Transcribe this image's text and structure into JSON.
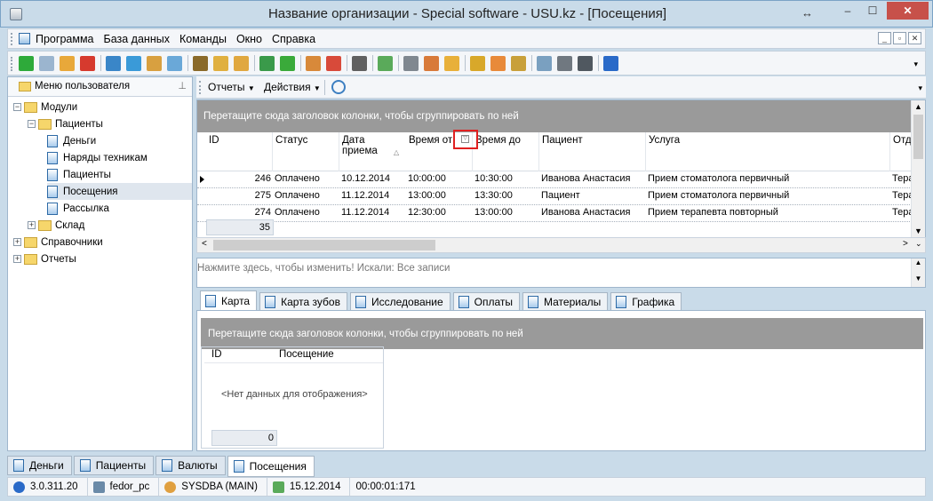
{
  "window": {
    "title": "Название организации - Special software - USU.kz - [Посещения]",
    "minimize": "–",
    "maximize": "☐",
    "close": "✕",
    "resize_glyph": "↔"
  },
  "menu": {
    "items": [
      "Программа",
      "База данных",
      "Команды",
      "Окно",
      "Справка"
    ],
    "mdi": [
      "_",
      "▫",
      "✕"
    ]
  },
  "toolbar": {
    "icons": [
      {
        "name": "add-icon",
        "color": "#2eaa3a"
      },
      {
        "name": "copy-icon",
        "color": "#9bb5cf"
      },
      {
        "name": "edit-icon",
        "color": "#e8a83a"
      },
      {
        "name": "delete-icon",
        "color": "#d63a2e"
      },
      {
        "sep": true
      },
      {
        "name": "search-icon",
        "color": "#3a86c8"
      },
      {
        "name": "refresh-icon",
        "color": "#3a9ad8"
      },
      {
        "name": "tree-icon",
        "color": "#d8a040"
      },
      {
        "name": "comment-icon",
        "color": "#6aa8d8"
      },
      {
        "sep": true
      },
      {
        "name": "binoculars-icon",
        "color": "#8a6a2a"
      },
      {
        "name": "filter-icon",
        "color": "#e0b040"
      },
      {
        "name": "group-icon",
        "color": "#e0a840"
      },
      {
        "sep": true
      },
      {
        "name": "export-icon",
        "color": "#3a9a4a"
      },
      {
        "name": "import-icon",
        "color": "#3aaa3a"
      },
      {
        "sep": true
      },
      {
        "name": "new-window-icon",
        "color": "#d8893a"
      },
      {
        "name": "close-window-icon",
        "color": "#d84a3a"
      },
      {
        "sep": true
      },
      {
        "name": "print-preview-icon",
        "color": "#606060"
      },
      {
        "sep": true
      },
      {
        "name": "calendar-icon",
        "color": "#5aaa5a"
      },
      {
        "sep": true
      },
      {
        "name": "tools-icon",
        "color": "#808890"
      },
      {
        "name": "palette-icon",
        "color": "#d87a3a"
      },
      {
        "name": "form-icon",
        "color": "#e8b03a"
      },
      {
        "sep": true
      },
      {
        "name": "lock-icon",
        "color": "#d8a82a"
      },
      {
        "name": "users-icon",
        "color": "#e88a3a"
      },
      {
        "name": "key-icon",
        "color": "#c8a03a"
      },
      {
        "sep": true
      },
      {
        "name": "table-icon",
        "color": "#7aa0c0"
      },
      {
        "name": "printer-icon",
        "color": "#707880"
      },
      {
        "name": "play-icon",
        "color": "#505860"
      },
      {
        "sep": true
      },
      {
        "name": "info-icon",
        "color": "#2a6ac8"
      }
    ],
    "more": "▾"
  },
  "left_panel": {
    "title": "Меню пользователя",
    "pin": "⊥",
    "tree": [
      {
        "label": "Модули",
        "type": "folder",
        "exp": "−"
      },
      {
        "label": "Пациенты",
        "type": "folder",
        "exp": "−"
      },
      {
        "label": "Деньги",
        "type": "leaf"
      },
      {
        "label": "Наряды техникам",
        "type": "leaf"
      },
      {
        "label": "Пациенты",
        "type": "leaf"
      },
      {
        "label": "Посещения",
        "type": "leaf",
        "selected": true
      },
      {
        "label": "Рассылка",
        "type": "leaf"
      },
      {
        "label": "Склад",
        "type": "folder",
        "exp": "+"
      },
      {
        "label": "Справочники",
        "type": "folder",
        "exp": "+"
      },
      {
        "label": "Отчеты",
        "type": "folder",
        "exp": "+"
      }
    ]
  },
  "right_toolbar": {
    "reports": "Отчеты",
    "actions": "Действия",
    "more": "▾"
  },
  "grid": {
    "group_hint": "Перетащите сюда заголовок колонки, чтобы сгруппировать по ней",
    "columns": [
      "ID",
      "Статус",
      "Дата приема",
      "Время от",
      "Время до",
      "Пациент",
      "Услуга",
      "Отд"
    ],
    "rows": [
      [
        "246",
        "Оплачено",
        "10.12.2014",
        "10:00:00",
        "10:30:00",
        "Иванова Анастасия",
        "Прием стоматолога первичный",
        "Тера"
      ],
      [
        "275",
        "Оплачено",
        "11.12.2014",
        "13:00:00",
        "13:30:00",
        "Пациент",
        "Прием стоматолога первичный",
        "Тера"
      ],
      [
        "274",
        "Оплачено",
        "11.12.2014",
        "12:30:00",
        "13:00:00",
        "Иванова Анастасия",
        "Прием терапевта повторный",
        "Тера"
      ]
    ],
    "count": "35",
    "filter_glyph": "▽"
  },
  "search": {
    "text": "Нажмите здесь, чтобы изменить! Искали: Все записи"
  },
  "detail_tabs": [
    "Карта",
    "Карта зубов",
    "Исследование",
    "Оплаты",
    "Материалы",
    "Графика"
  ],
  "detail": {
    "group_hint": "Перетащите сюда заголовок колонки, чтобы сгруппировать по ней",
    "columns": [
      "ID",
      "Посещение"
    ],
    "no_data": "<Нет данных для отображения>",
    "count": "0"
  },
  "bottom_tabs": [
    "Деньги",
    "Пациенты",
    "Валюты",
    "Посещения"
  ],
  "status": {
    "version": "3.0.311.20",
    "computer": "fedor_pc",
    "user": "SYSDBA (MAIN)",
    "date": "15.12.2014",
    "elapsed": "00:00:01:171"
  }
}
